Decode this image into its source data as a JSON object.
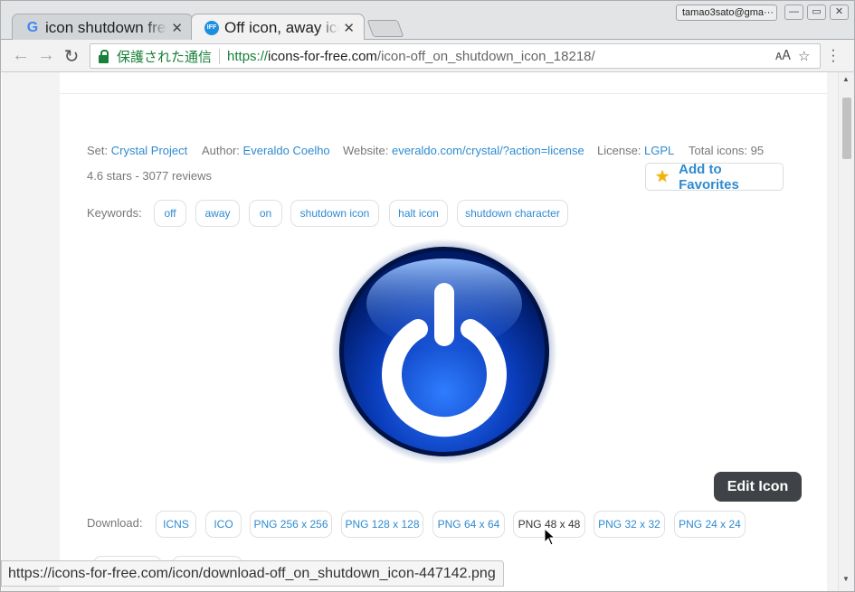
{
  "browser": {
    "tabs": [
      {
        "title": "icon shutdown free",
        "favicon": "google-g-icon",
        "active": false
      },
      {
        "title": "Off icon, away icon",
        "favicon": "icons-for-free-icon",
        "favicon_text": "IFF",
        "active": true
      }
    ],
    "profile_label": "tamao3sato@gma···",
    "address": {
      "secure_label": "保護された通信",
      "scheme": "https://",
      "domain": "icons-for-free.com",
      "path": "/icon-off_on_shutdown_icon_18218/"
    },
    "status_url": "https://icons-for-free.com/icon/download-off_on_shutdown_icon-447142.png"
  },
  "page": {
    "meta": {
      "set_label": "Set:",
      "set_value": "Crystal Project",
      "author_label": "Author:",
      "author_value": "Everaldo Coelho",
      "website_label": "Website:",
      "website_value": "everaldo.com/crystal/?action=license",
      "license_label": "License:",
      "license_value": "LGPL",
      "total_label": "Total icons: 95"
    },
    "rating": "4.6 stars - 3077 reviews",
    "favorites_label": "Add to Favorites",
    "keywords_label": "Keywords:",
    "keywords": [
      "off",
      "away",
      "on",
      "shutdown icon",
      "halt icon",
      "shutdown character"
    ],
    "edit_label": "Edit Icon",
    "download_label": "Download:",
    "downloads": [
      "ICNS",
      "ICO",
      "PNG 256 x 256",
      "PNG 128 x 128",
      "PNG 64 x 64",
      "PNG 48 x 48",
      "PNG 32 x 32",
      "PNG 24 x 24"
    ],
    "hovered_download": "PNG 48 x 48"
  },
  "colors": {
    "link": "#2e8bd0",
    "secure": "#188038",
    "edit_button": "#3f4246",
    "icon_blue": "#0a3fb8"
  }
}
